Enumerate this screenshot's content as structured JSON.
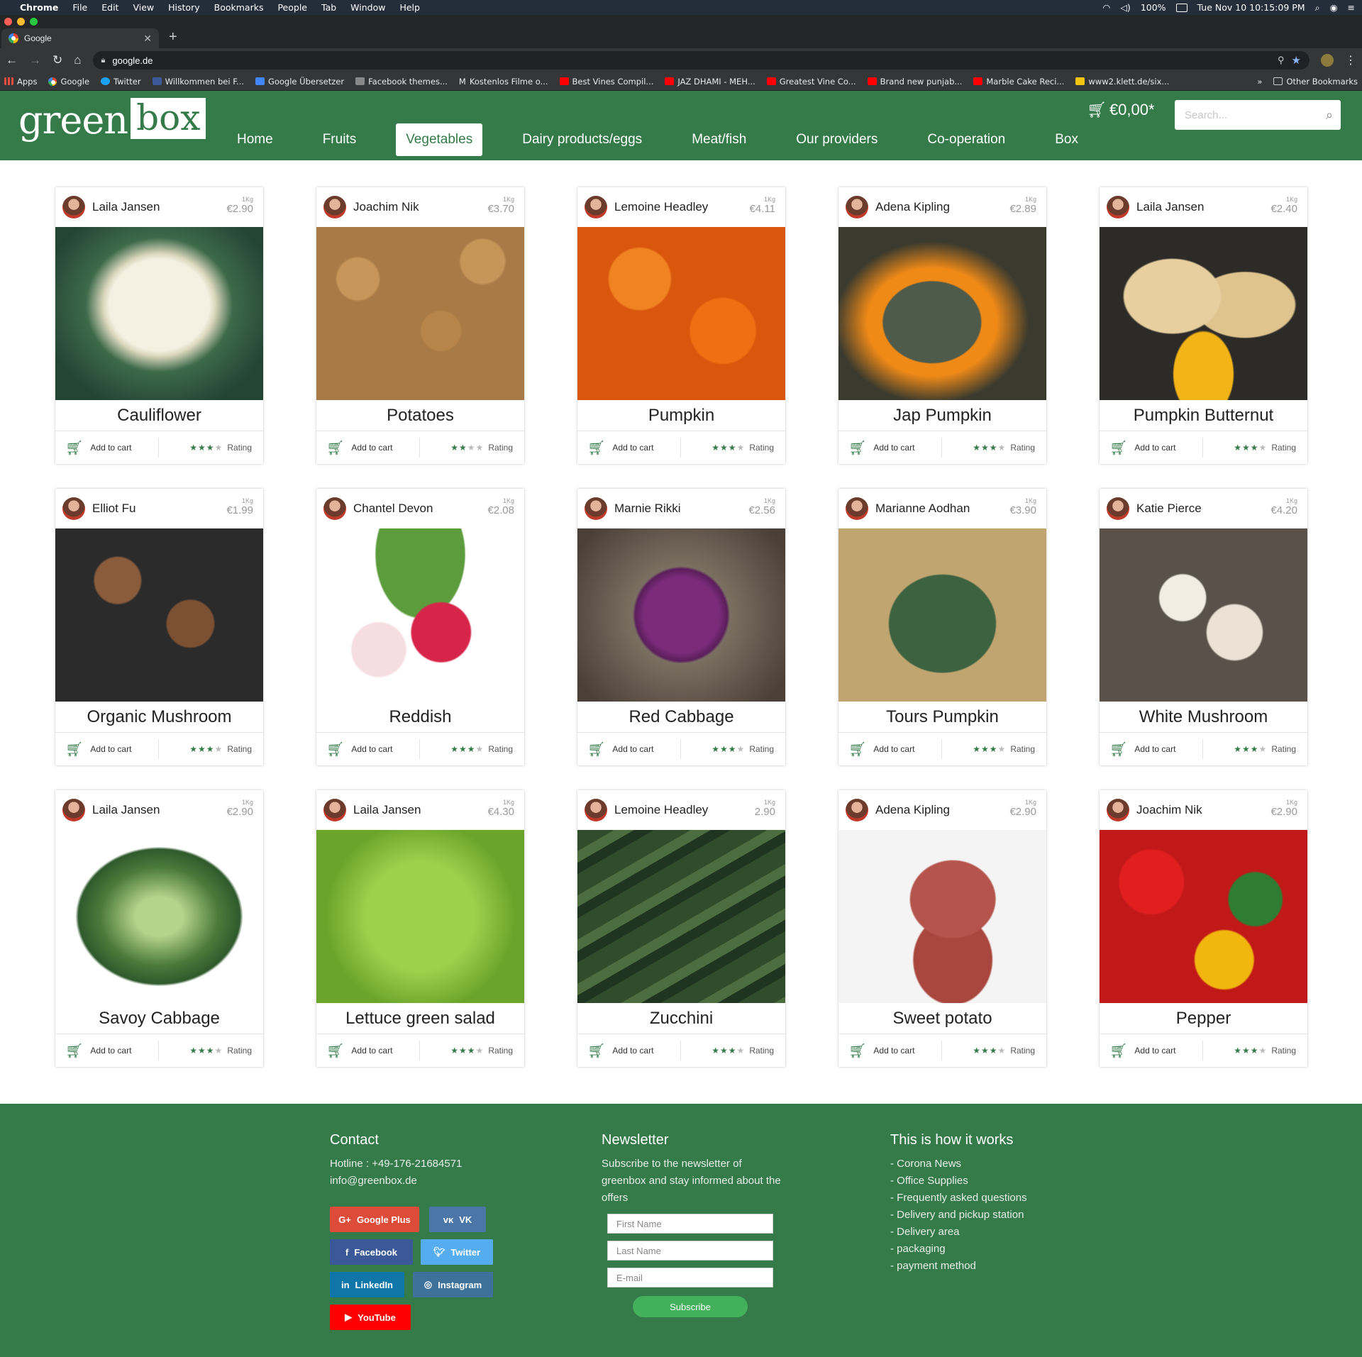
{
  "os_menubar": {
    "apple": "",
    "items": [
      "Chrome",
      "File",
      "Edit",
      "View",
      "History",
      "Bookmarks",
      "People",
      "Tab",
      "Window",
      "Help"
    ],
    "battery": "100%",
    "datetime": "Tue Nov 10  10:15:09 PM"
  },
  "browser": {
    "tab_title": "Google",
    "url": "google.de",
    "bookmarks": [
      {
        "label": "Apps",
        "icon": "apps-grid-icon"
      },
      {
        "label": "Google",
        "icon": "google-icon"
      },
      {
        "label": "Twitter",
        "icon": "twitter-icon"
      },
      {
        "label": "Willkommen bei F...",
        "icon": "facebook-icon"
      },
      {
        "label": "Google Übersetzer",
        "icon": "translate-icon"
      },
      {
        "label": "Facebook themes...",
        "icon": "theme-icon"
      },
      {
        "label": "Kostenlos Filme o...",
        "icon": "m-icon"
      },
      {
        "label": "Best Vines Compil...",
        "icon": "youtube-icon"
      },
      {
        "label": "JAZ DHAMI - MEH...",
        "icon": "youtube-icon"
      },
      {
        "label": "Greatest Vine Co...",
        "icon": "youtube-icon"
      },
      {
        "label": "Brand new punjab...",
        "icon": "youtube-icon"
      },
      {
        "label": "Marble Cake Reci...",
        "icon": "youtube-icon"
      },
      {
        "label": "www2.klett.de/six...",
        "icon": "klett-icon"
      }
    ],
    "overflow": "»",
    "other_bookmarks": "Other Bookmarks"
  },
  "site": {
    "logo_green": "green",
    "logo_box": "box",
    "nav": [
      "Home",
      "Fruits",
      "Vegetables",
      "Dairy products/eggs",
      "Meat/fish",
      "Our providers",
      "Co-operation",
      "Box"
    ],
    "active_nav": "Vegetables",
    "cart_total": "€0,00*",
    "search_placeholder": "Search..."
  },
  "products": [
    {
      "seller": "Laila Jansen",
      "unit": "1Kg",
      "price": "€2.90",
      "name": "Cauliflower",
      "stars": 3,
      "add": "Add to cart",
      "rating": "Rating"
    },
    {
      "seller": "Joachim Nik",
      "unit": "1Kg",
      "price": "€3.70",
      "name": "Potatoes",
      "stars": 2,
      "add": "Add to cart",
      "rating": "Rating"
    },
    {
      "seller": "Lemoine Headley",
      "unit": "1Kg",
      "price": "€4.11",
      "name": "Pumpkin",
      "stars": 3,
      "add": "Add to cart",
      "rating": "Rating"
    },
    {
      "seller": "Adena Kipling",
      "unit": "1Kg",
      "price": "€2.89",
      "name": "Jap Pumpkin",
      "stars": 3,
      "add": "Add to cart",
      "rating": "Rating"
    },
    {
      "seller": "Laila Jansen",
      "unit": "1Kg",
      "price": "€2.40",
      "name": "Pumpkin Butternut",
      "stars": 3,
      "add": "Add to cart",
      "rating": "Rating"
    },
    {
      "seller": "Elliot Fu",
      "unit": "1Kg",
      "price": "€1.99",
      "name": "Organic Mushroom",
      "stars": 3,
      "add": "Add to cart",
      "rating": "Rating"
    },
    {
      "seller": "Chantel Devon",
      "unit": "1Kg",
      "price": "€2.08",
      "name": "Reddish",
      "stars": 3,
      "add": "Add to cart",
      "rating": "Rating"
    },
    {
      "seller": "Marnie Rikki",
      "unit": "1Kg",
      "price": "€2.56",
      "name": "Red Cabbage",
      "stars": 3,
      "add": "Add to cart",
      "rating": "Rating"
    },
    {
      "seller": "Marianne Aodhan",
      "unit": "1Kg",
      "price": "€3.90",
      "name": "Tours Pumpkin",
      "stars": 3,
      "add": "Add to cart",
      "rating": "Rating"
    },
    {
      "seller": "Katie Pierce",
      "unit": "1Kg",
      "price": "€4.20",
      "name": "White Mushroom",
      "stars": 3,
      "add": "Add to cart",
      "rating": "Rating"
    },
    {
      "seller": "Laila Jansen",
      "unit": "1Kg",
      "price": "€2.90",
      "name": "Savoy Cabbage",
      "stars": 3,
      "add": "Add to cart",
      "rating": "Rating"
    },
    {
      "seller": "Laila Jansen",
      "unit": "1Kg",
      "price": "€4.30",
      "name": "Lettuce green salad",
      "stars": 3,
      "add": "Add to cart",
      "rating": "Rating"
    },
    {
      "seller": "Lemoine Headley",
      "unit": "1Kg",
      "price": "2.90",
      "name": "Zucchini",
      "stars": 3,
      "add": "Add to cart",
      "rating": "Rating"
    },
    {
      "seller": "Adena Kipling",
      "unit": "1Kg",
      "price": "€2.90",
      "name": "Sweet potato",
      "stars": 3,
      "add": "Add to cart",
      "rating": "Rating"
    },
    {
      "seller": "Joachim Nik",
      "unit": "1Kg",
      "price": "€2.90",
      "name": "Pepper",
      "stars": 3,
      "add": "Add to cart",
      "rating": "Rating"
    }
  ],
  "footer": {
    "contact": {
      "title": "Contact",
      "hotline": "Hotline : +49-176-21684571",
      "email": "info@greenbox.de"
    },
    "social": [
      "Google Plus",
      "VK",
      "Facebook",
      "Twitter",
      "LinkedIn",
      "Instagram",
      "YouTube"
    ],
    "newsletter": {
      "title": "Newsletter",
      "text": "Subscribe to the newsletter of greenbox and stay informed about the offers",
      "first_name": "First Name",
      "last_name": "Last Name",
      "email": "E-mail",
      "button": "Subscribe"
    },
    "how": {
      "title": "This is how it works",
      "items": [
        "- Corona News",
        "- Office Supplies",
        "- Frequently asked questions",
        "- Delivery and pickup station",
        "- Delivery area",
        "- packaging",
        "- payment method"
      ]
    }
  },
  "colors": {
    "brand": "#357a49",
    "google_plus": "#dd4b39",
    "vk": "#4a76a8",
    "facebook": "#3b5998",
    "twitter": "#55acee",
    "linkedin": "#0e76a8",
    "instagram": "#3f729b",
    "youtube": "#ff0000"
  }
}
